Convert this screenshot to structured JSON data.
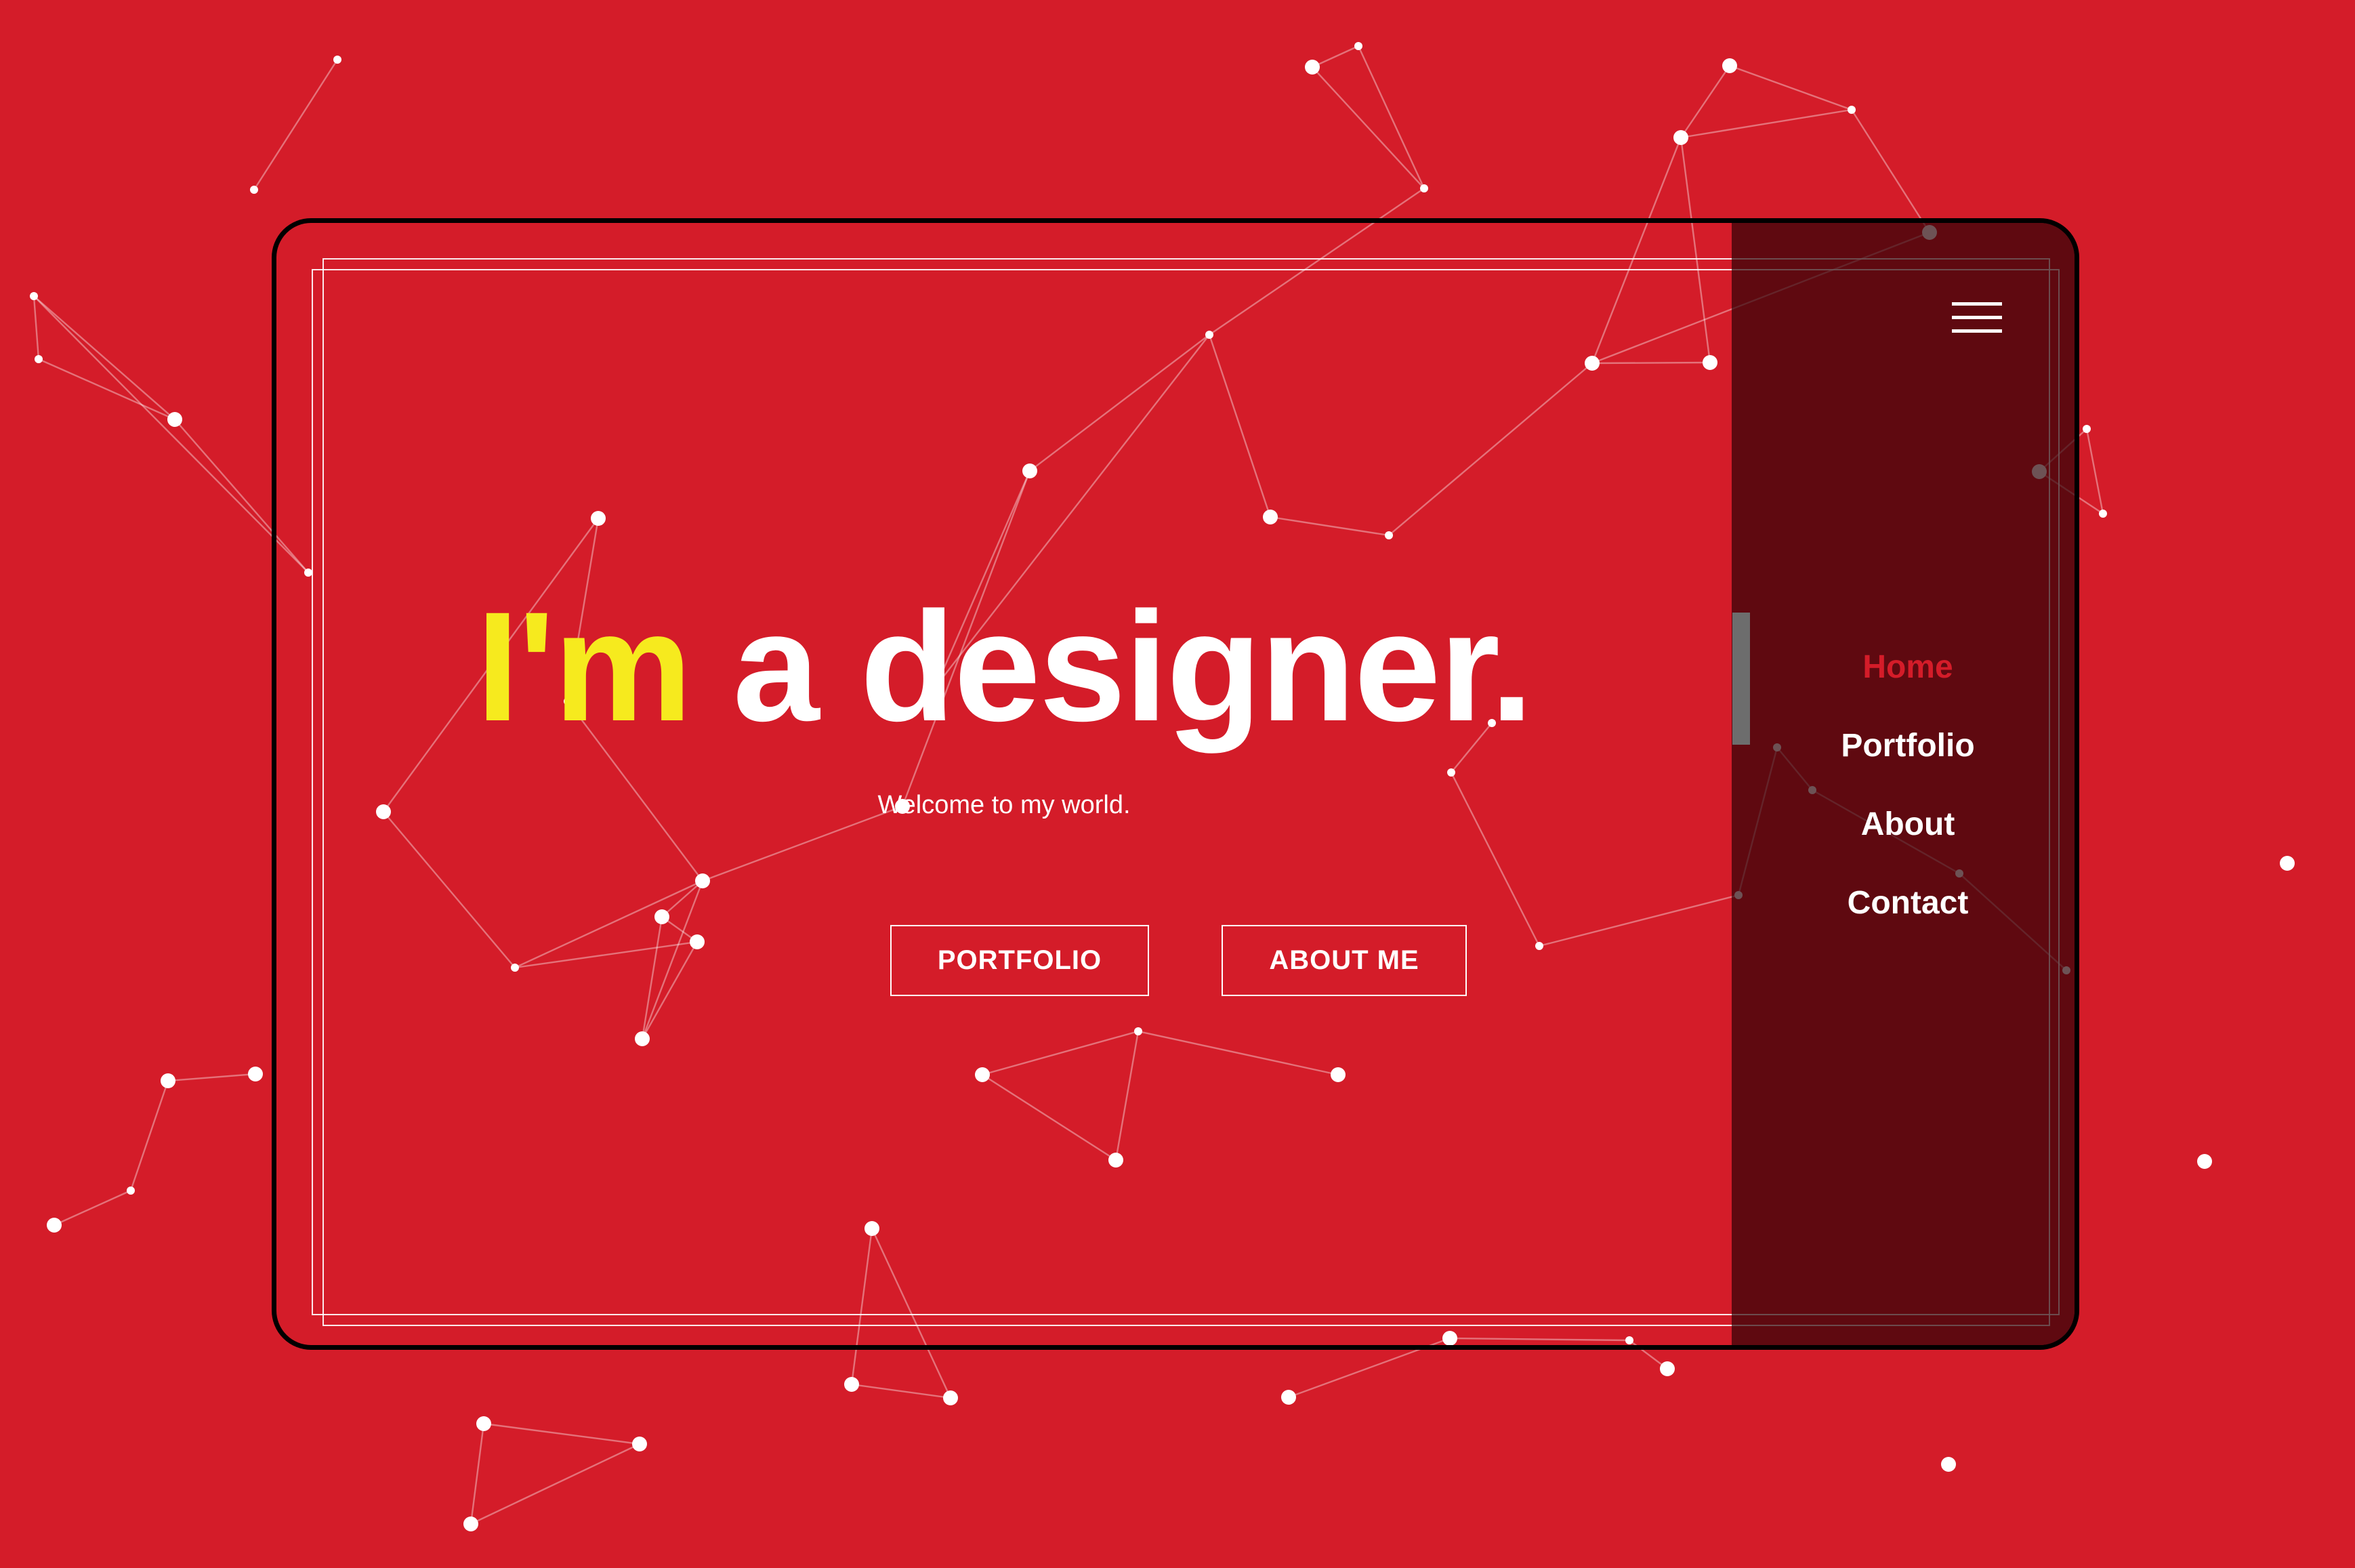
{
  "colors": {
    "background": "#d41c29",
    "headline_accent": "#f6ea1e",
    "text": "#ffffff",
    "nav_active": "#d41c29",
    "side_panel": "#52080f",
    "device_border": "#000000"
  },
  "hero": {
    "headline_accent": "I'm",
    "headline_rest": "a designer.",
    "subtitle": "Welcome to my world."
  },
  "buttons": {
    "portfolio": "PORTFOLIO",
    "about_me": "ABOUT ME"
  },
  "menu": {
    "icon": "hamburger-menu-icon",
    "items": [
      {
        "label": "Home",
        "active": true
      },
      {
        "label": "Portfolio",
        "active": false
      },
      {
        "label": "About",
        "active": false
      },
      {
        "label": "Contact",
        "active": false
      }
    ]
  }
}
